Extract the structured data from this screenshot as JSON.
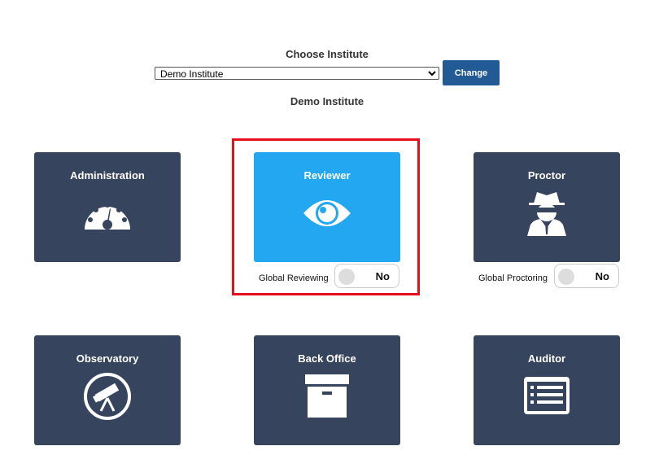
{
  "institute_picker": {
    "title": "Choose Institute",
    "selected": "Demo Institute",
    "options": [
      "Demo Institute"
    ],
    "change_label": "Change",
    "current_institute": "Demo Institute"
  },
  "tiles": {
    "administration": {
      "label": "Administration",
      "icon": "dashboard-gauge-icon"
    },
    "reviewer": {
      "label": "Reviewer",
      "icon": "eye-icon",
      "active": true
    },
    "proctor": {
      "label": "Proctor",
      "icon": "user-secret-icon"
    },
    "observatory": {
      "label": "Observatory",
      "icon": "telescope-icon"
    },
    "back_office": {
      "label": "Back Office",
      "icon": "archive-box-icon"
    },
    "auditor": {
      "label": "Auditor",
      "icon": "list-alt-icon"
    }
  },
  "toggles": {
    "global_reviewing": {
      "label": "Global Reviewing",
      "state": "No"
    },
    "global_proctoring": {
      "label": "Global Proctoring",
      "state": "No"
    }
  },
  "colors": {
    "tile": "#36445e",
    "tile_active": "#22a7f0",
    "button": "#225a96",
    "highlight": "#e3101b"
  }
}
